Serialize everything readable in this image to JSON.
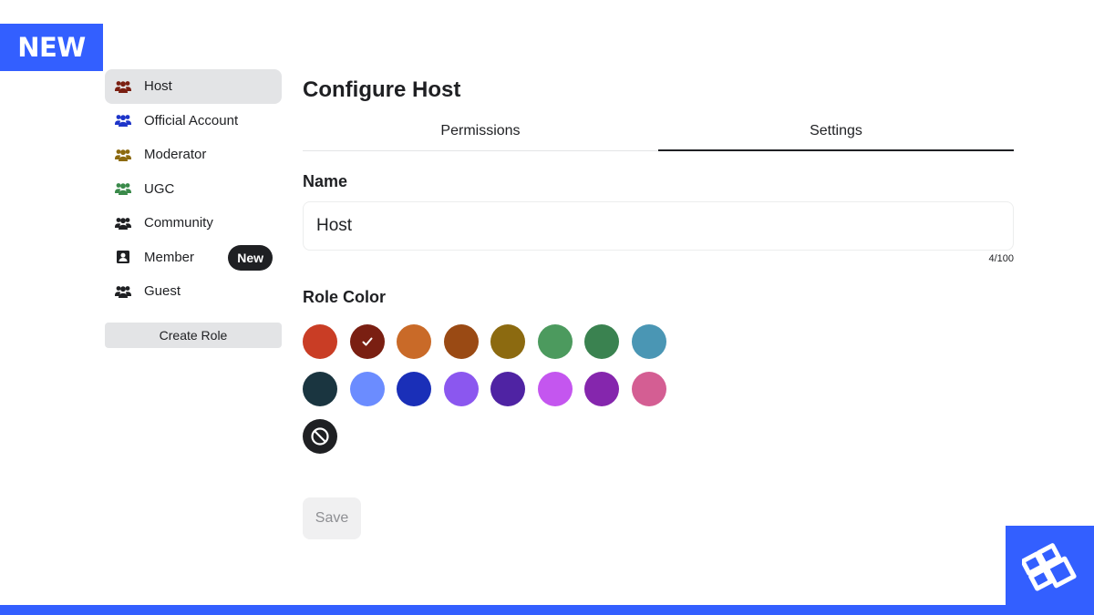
{
  "corner_badge": "NEW",
  "sidebar": {
    "items": [
      {
        "label": "Host",
        "color": "#7a1f12",
        "icon": "people-icon",
        "active": true
      },
      {
        "label": "Official Account",
        "color": "#1e35c9",
        "icon": "people-icon"
      },
      {
        "label": "Moderator",
        "color": "#8c6a10",
        "icon": "people-icon"
      },
      {
        "label": "UGC",
        "color": "#3a8a4a",
        "icon": "people-icon"
      },
      {
        "label": "Community",
        "color": "#1f2023",
        "icon": "people-icon"
      },
      {
        "label": "Member",
        "color": "#1f2023",
        "icon": "member-card-icon",
        "badge": "New"
      },
      {
        "label": "Guest",
        "color": "#1f2023",
        "icon": "people-icon"
      }
    ],
    "create_role_label": "Create Role"
  },
  "main": {
    "title": "Configure Host",
    "tabs": [
      {
        "label": "Permissions",
        "active": false
      },
      {
        "label": "Settings",
        "active": true
      }
    ],
    "name_label": "Name",
    "name_value": "Host",
    "name_counter": "4/100",
    "role_color_label": "Role Color",
    "role_colors": [
      "#c93d25",
      "#7a1f12",
      "#c96a28",
      "#9a4a14",
      "#8c6a10",
      "#4c9a5e",
      "#3a8250",
      "#4a96b4",
      "#1a3540",
      "#6b8cff",
      "#1a2fb8",
      "#8b57ef",
      "#4f23a3",
      "#c456ef",
      "#8526ad",
      "#d45e93"
    ],
    "selected_color_index": 1,
    "no_color_icon": "no-color-icon",
    "save_label": "Save"
  },
  "brand": {
    "accent": "#335fff",
    "logo": "blox-logo-icon"
  }
}
